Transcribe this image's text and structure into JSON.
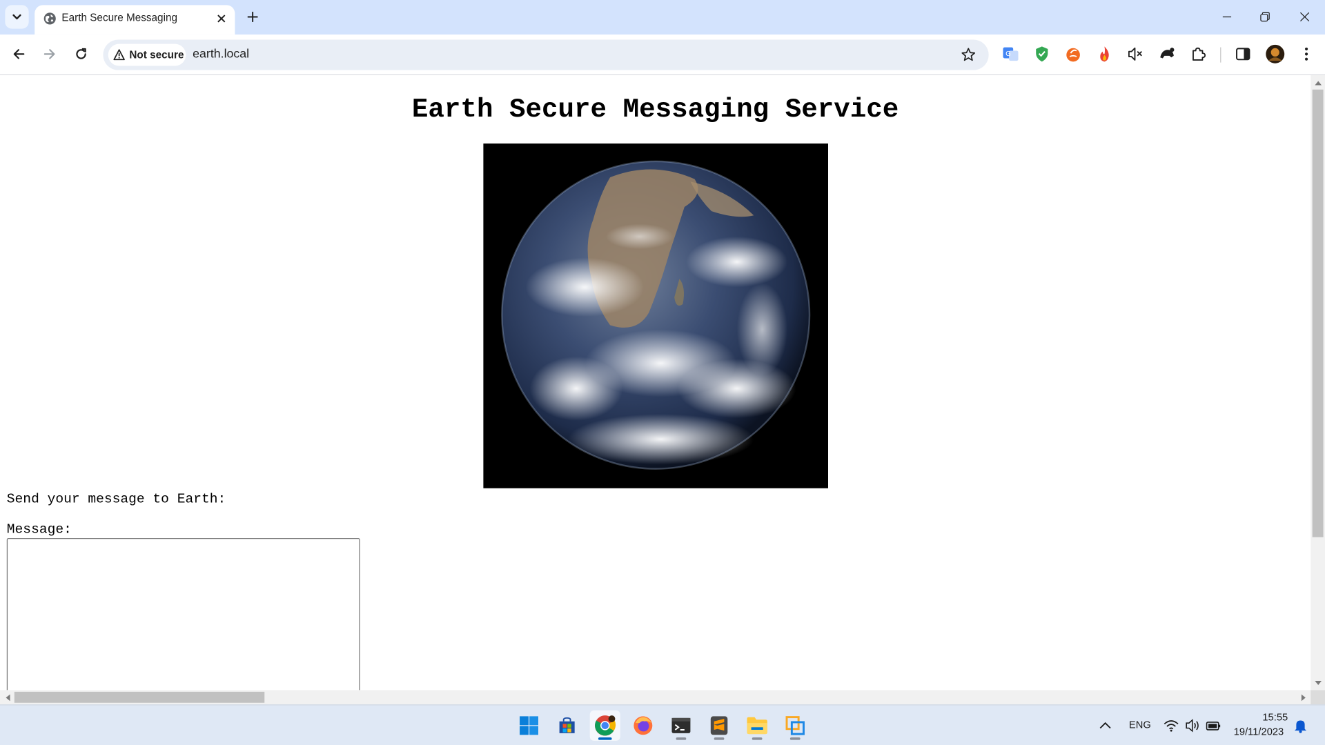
{
  "browser": {
    "tab": {
      "title": "Earth Secure Messaging"
    },
    "omnibox": {
      "security_label": "Not secure",
      "url": "earth.local"
    },
    "extensions": [
      "google-translate-icon",
      "shield-extension-icon",
      "orange-extension-icon",
      "flame-extension-icon",
      "mute-icon",
      "turtle-extension-icon",
      "puzzle-extensions-icon"
    ]
  },
  "page": {
    "title": "Earth Secure Messaging Service",
    "image_alt": "earth-image",
    "send_prompt": "Send your message to Earth:",
    "message_label": "Message:",
    "message_value": ""
  },
  "taskbar": {
    "apps": [
      "start-button",
      "microsoft-store",
      "chrome",
      "firefox",
      "terminal",
      "sublime-text",
      "file-explorer",
      "virtual-machine-app"
    ],
    "tray": {
      "language": "ENG",
      "time": "15:55",
      "date": "19/11/2023"
    }
  },
  "colors": {
    "tabstrip_bg": "#d3e3fd",
    "omnibox_bg": "#e9eef6",
    "taskbar_bg": "#dfe8f5",
    "accent": "#0067c0"
  }
}
